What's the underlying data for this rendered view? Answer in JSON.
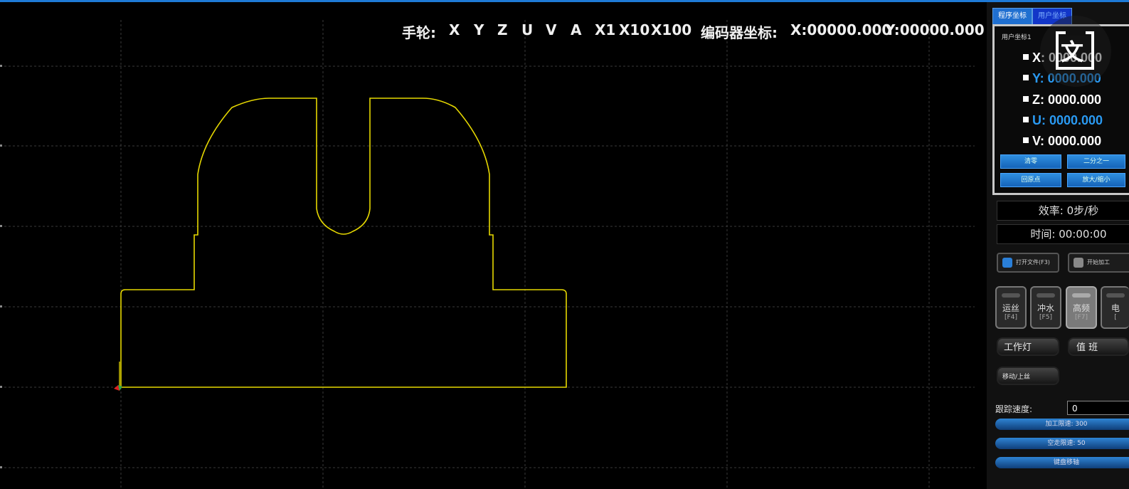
{
  "header": {
    "handwheel_label": "手轮:",
    "axes": [
      "X",
      "Y",
      "Z",
      "U",
      "V",
      "A"
    ],
    "multipliers": [
      "X1",
      "X10",
      "X100"
    ],
    "encoder_label": "编码器坐标:",
    "encoder_x": "X:00000.000",
    "encoder_y": "Y:00000.000"
  },
  "tabs": [
    "程序坐标",
    "用户坐标"
  ],
  "coord_panel": {
    "title": "用户坐标1",
    "rows": [
      {
        "label": "X: 0000.000",
        "color": "white"
      },
      {
        "label": "Y: 0000.000",
        "color": "blue"
      },
      {
        "label": "Z: 0000.000",
        "color": "white"
      },
      {
        "label": "U: 0000.000",
        "color": "blue"
      },
      {
        "label": "V: 0000.000",
        "color": "white"
      }
    ],
    "buttons": [
      "清零",
      "二分之一",
      "回原点",
      "放大/缩小"
    ]
  },
  "overlay_icon": {
    "glyph": "文",
    "name": "translate-icon"
  },
  "status": {
    "efficiency": "效率: 0步/秒",
    "time": "时间: 00:00:00"
  },
  "file_buttons": {
    "open": "打开文件(F3)",
    "start": "开始加工"
  },
  "toggles": [
    {
      "label": "运丝",
      "key": "[F4]",
      "light": false
    },
    {
      "label": "冲水",
      "key": "[F5]",
      "light": false
    },
    {
      "label": "高频",
      "key": "[F7]",
      "light": true
    },
    {
      "label": "电",
      "key": "[",
      "light": false
    }
  ],
  "work_light": "工作灯",
  "duty": "值 班",
  "threading": "移动/上丝",
  "tracking_speed": {
    "label": "跟踪速度:",
    "value": "0"
  },
  "speed_bars": [
    "加工限速: 300",
    "空走限速: 50",
    "键盘移轴"
  ],
  "colors": {
    "path": "#e6d800",
    "accent": "#1e7ad6",
    "blue_text": "#2a9af2"
  }
}
